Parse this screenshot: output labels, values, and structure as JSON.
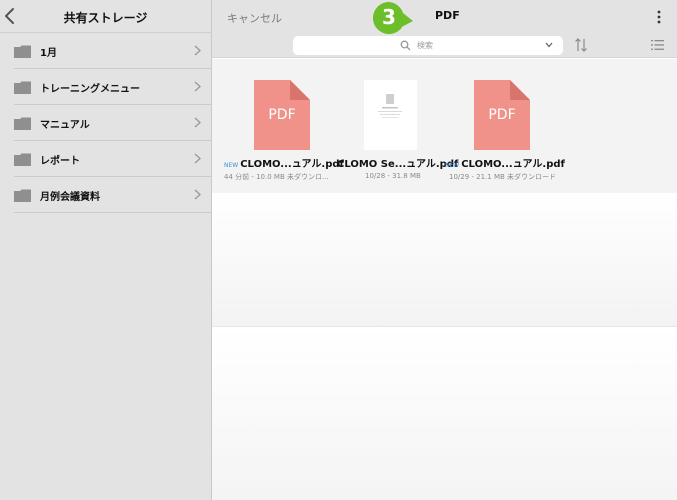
{
  "sidebar": {
    "title": "共有ストレージ",
    "folders": [
      {
        "label": "1月"
      },
      {
        "label": "トレーニングメニュー"
      },
      {
        "label": "マニュアル"
      },
      {
        "label": "レポート"
      },
      {
        "label": "月例会議資料"
      }
    ]
  },
  "header": {
    "cancel_label": "キャンセル",
    "title": "PDF",
    "step_badge": "3"
  },
  "search": {
    "placeholder": "検索"
  },
  "files": [
    {
      "new_badge": "NEW",
      "name": "CLOMO...ュアル.pdf",
      "meta": "44 分前 - 10.0 MB   未ダウンロ...",
      "thumb_text": "PDF"
    },
    {
      "new_badge": "",
      "name": "CLOMO Se...ュアル.pdf",
      "meta": "10/28 - 31.8 MB",
      "thumb_text": ""
    },
    {
      "new_badge": "NEW",
      "name": "CLOMO...ュアル.pdf",
      "meta": "10/29 - 21.1 MB   未ダウンロード",
      "thumb_text": "PDF"
    }
  ],
  "colors": {
    "badge_green": "#6cbf2a",
    "pdf_thumb": "#f0928a",
    "pdf_fold": "#d9746d",
    "new_blue": "#3a8fd9"
  }
}
